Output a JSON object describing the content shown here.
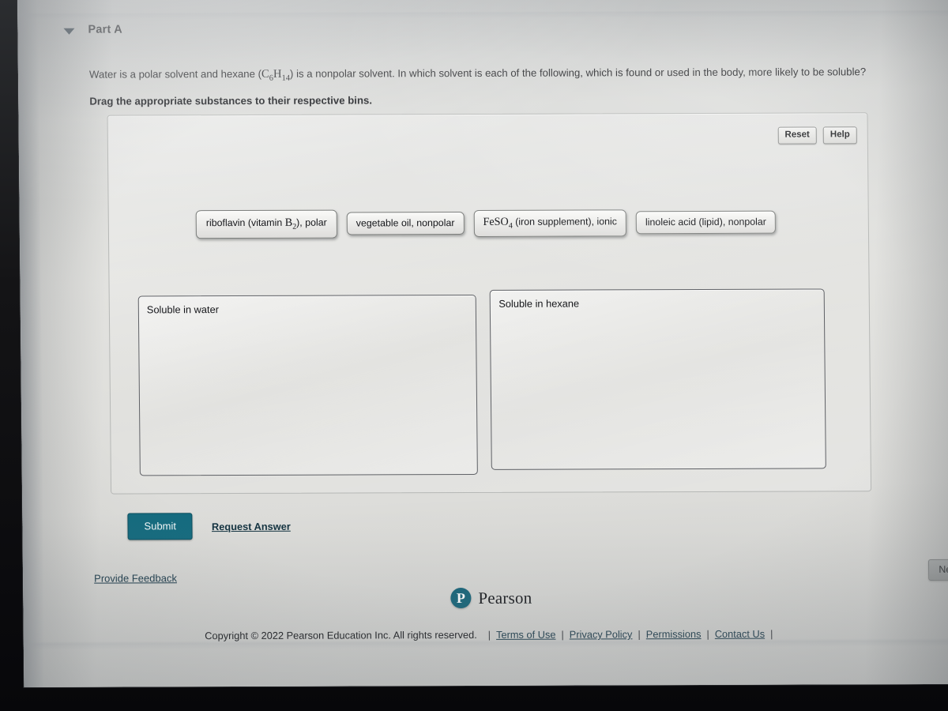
{
  "part": {
    "caret_icon": "triangle-down-icon",
    "title": "Part A"
  },
  "question": {
    "text_before_formula": "Water is a polar solvent and hexane (",
    "formula_c": "C",
    "formula_c_sub": "6",
    "formula_h": "H",
    "formula_h_sub": "14",
    "text_after_formula": ") is a nonpolar solvent. In which solvent is each of the following, which is found or used in the body, more likely to be soluble?",
    "instruction": "Drag the appropriate substances to their respective bins."
  },
  "toolbar": {
    "reset_label": "Reset",
    "help_label": "Help"
  },
  "chips": [
    {
      "id": "riboflavin",
      "pre": "riboflavin (vitamin ",
      "formula": "B",
      "formula_sub": "2",
      "post": "), polar"
    },
    {
      "id": "vegetable-oil",
      "pre": "vegetable oil, nonpolar",
      "formula": "",
      "formula_sub": "",
      "post": ""
    },
    {
      "id": "iron-sulfate",
      "pre": "",
      "formula": "FeSO",
      "formula_sub": "4",
      "post": " (iron supplement), ionic"
    },
    {
      "id": "linoleic-acid",
      "pre": "linoleic acid (lipid), nonpolar",
      "formula": "",
      "formula_sub": "",
      "post": ""
    }
  ],
  "bins": [
    {
      "id": "soluble-in-water",
      "label": "Soluble in water",
      "contents": []
    },
    {
      "id": "soluble-in-hexane",
      "label": "Soluble in hexane",
      "contents": []
    }
  ],
  "actions": {
    "submit_label": "Submit",
    "request_answer_label": "Request Answer",
    "provide_feedback_label": "Provide Feedback",
    "next_label": "Next"
  },
  "footer": {
    "brand_mark": "P",
    "brand_name": "Pearson",
    "copyright": "Copyright © 2022 Pearson Education Inc. All rights reserved.",
    "separator": "|",
    "links": [
      "Terms of Use",
      "Privacy Policy",
      "Permissions",
      "Contact Us"
    ]
  },
  "colors": {
    "submit_teal": "#146b7f",
    "link_blue": "#1d3c4c",
    "page_bg": "#e2e2df",
    "bezel_dark": "#141416"
  }
}
